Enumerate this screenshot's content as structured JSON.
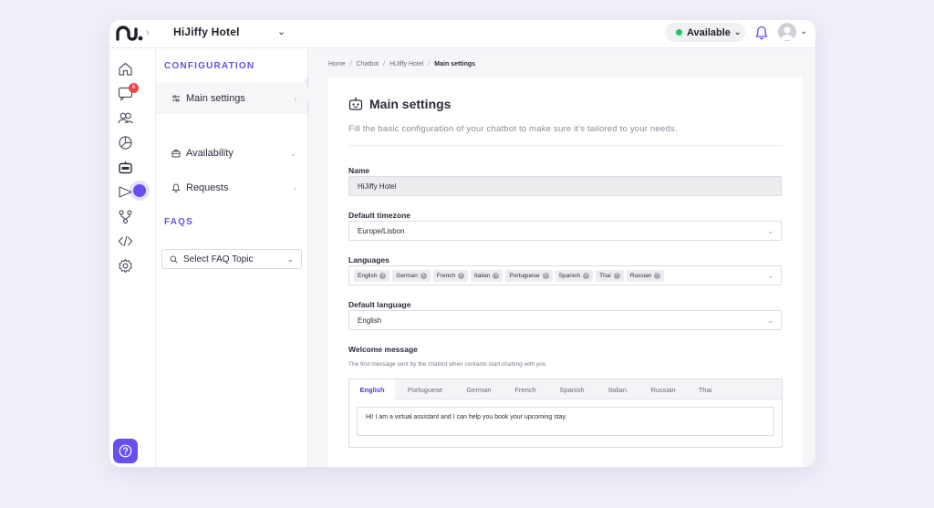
{
  "topbar": {
    "org_name": "HiJiffy Hotel",
    "status": "Available",
    "status_color": "#22c55e"
  },
  "rail": {
    "icons": [
      "home-icon",
      "chat-icon",
      "users-icon",
      "analytics-icon",
      "bot-icon",
      "campaign-icon",
      "integrations-icon",
      "code-icon",
      "settings-icon"
    ],
    "chat_badge": "6",
    "help_icon": "question-icon"
  },
  "nav": {
    "configuration_title": "CONFIGURATION",
    "items": [
      {
        "label": "Main settings"
      },
      {
        "label": "Availability"
      },
      {
        "label": "Requests"
      }
    ],
    "faqs_title": "FAQS",
    "faq_select": "Select FAQ Topic"
  },
  "breadcrumb": [
    "Home",
    "Chatbot",
    "HiJiffy Hotel",
    "Main settings"
  ],
  "card": {
    "title": "Main settings",
    "description": "Fill the basic configuration of your chatbot to make sure it's tailored to your needs."
  },
  "form": {
    "name_label": "Name",
    "name_value": "HiJiffy Hotel",
    "timezone_label": "Default timezone",
    "timezone_value": "Europe/Lisbon",
    "languages_label": "Languages",
    "languages": [
      "English",
      "German",
      "French",
      "Italian",
      "Portuguese",
      "Spanish",
      "Thai",
      "Russian"
    ],
    "default_language_label": "Default language",
    "default_language_value": "English",
    "welcome_label": "Welcome message",
    "welcome_hint": "The first message sent by the chatbot when contacts start chatting with you",
    "welcome_tabs": [
      "English",
      "Portuguese",
      "German",
      "French",
      "Spanish",
      "Italian",
      "Russian",
      "Thai"
    ],
    "welcome_text": "Hi! I am a virtual assistant and I can help you book your upcoming stay."
  },
  "colors": {
    "accent": "#6b4ef0",
    "badge": "#ef4444"
  }
}
